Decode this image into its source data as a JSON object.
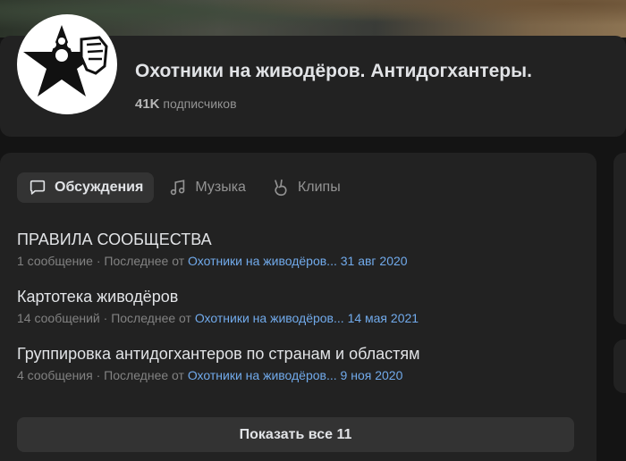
{
  "header": {
    "title": "Охотники на живодёров. Антидогхантеры.",
    "subscribers_count": "41K",
    "subscribers_label": "подписчиков"
  },
  "tabs": [
    {
      "label": "Обсуждения",
      "icon": "discussion-icon",
      "active": true
    },
    {
      "label": "Музыка",
      "icon": "music-icon",
      "active": false
    },
    {
      "label": "Клипы",
      "icon": "clips-icon",
      "active": false
    }
  ],
  "topics": [
    {
      "title": "ПРАВИЛА СООБЩЕСТВА",
      "count": "1 сообщение",
      "last_prefix": "Последнее от",
      "author": "Охотники на живодёров...",
      "date": "31 авг 2020"
    },
    {
      "title": "Картотека живодёров",
      "count": "14 сообщений",
      "last_prefix": "Последнее от",
      "author": "Охотники на живодёров...",
      "date": "14 мая 2021"
    },
    {
      "title": "Группировка антидогхантеров по странам и областям",
      "count": "4 сообщения",
      "last_prefix": "Последнее от",
      "author": "Охотники на живодёров...",
      "date": "9 ноя 2020"
    }
  ],
  "show_all_label": "Показать все 11",
  "separator": "·",
  "colors": {
    "link": "#71aaeb",
    "card": "#222222",
    "background": "#141414"
  }
}
